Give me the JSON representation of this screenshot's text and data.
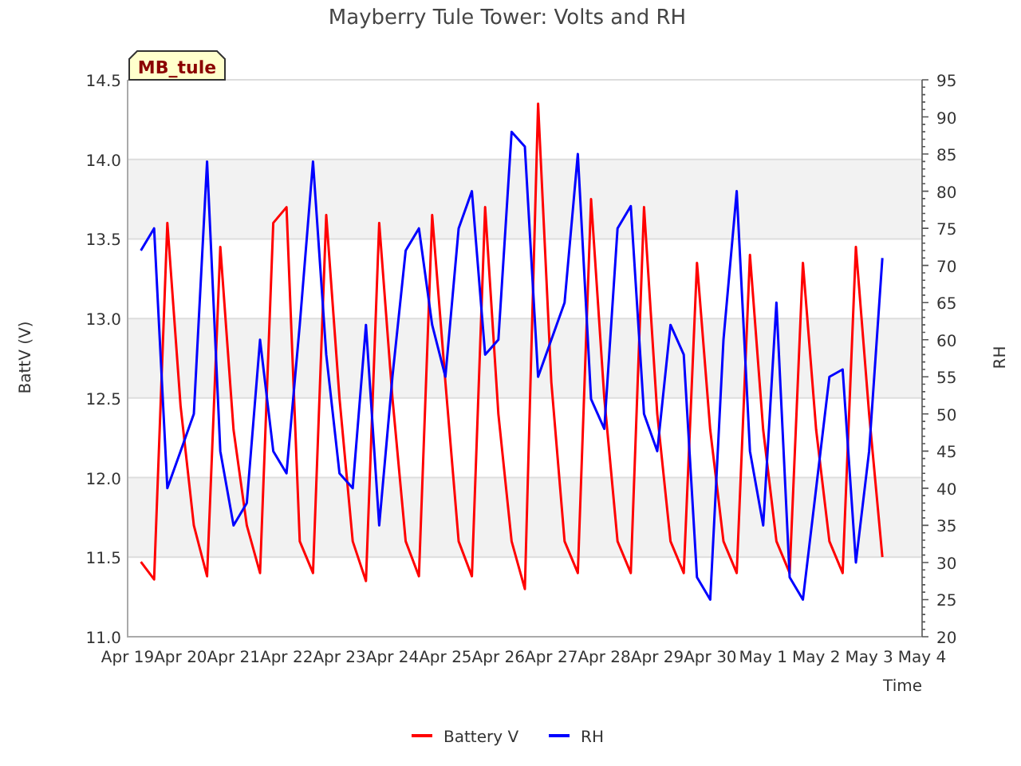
{
  "station_label": "MB_tule",
  "chart_data": {
    "type": "line",
    "title": "Mayberry Tule Tower: Volts and RH",
    "xlabel": "Time",
    "ylabel": "BattV (V)",
    "y2label": "RH",
    "categories": [
      "Apr 19",
      null,
      null,
      null,
      "Apr 20",
      null,
      null,
      null,
      "Apr 21",
      null,
      null,
      null,
      "Apr 22",
      null,
      null,
      null,
      "Apr 23",
      null,
      null,
      null,
      "Apr 24",
      null,
      null,
      null,
      "Apr 25",
      null,
      null,
      null,
      "Apr 26",
      null,
      null,
      null,
      "Apr 27",
      null,
      null,
      null,
      "Apr 28",
      null,
      null,
      null,
      "Apr 29",
      null,
      null,
      null,
      "Apr 30",
      null,
      null,
      null,
      "May 1",
      null,
      null,
      null,
      "May 2",
      null,
      null,
      null,
      "May 3",
      null,
      null,
      null,
      "May 4"
    ],
    "series": [
      {
        "name": "Battery V",
        "color": "#ff0000",
        "values": [
          null,
          11.47,
          11.36,
          13.6,
          12.45,
          11.7,
          11.38,
          13.45,
          12.3,
          11.7,
          11.4,
          13.6,
          13.7,
          11.6,
          11.4,
          13.65,
          12.5,
          11.6,
          11.35,
          13.6,
          12.5,
          11.6,
          11.38,
          13.65,
          12.6,
          11.6,
          11.38,
          13.7,
          12.4,
          11.6,
          11.3,
          14.35,
          12.6,
          11.6,
          11.4,
          13.75,
          12.5,
          11.6,
          11.4,
          13.7,
          12.4,
          11.6,
          11.4,
          13.35,
          12.3,
          11.6,
          11.4,
          13.4,
          12.3,
          11.6,
          11.4,
          13.35,
          12.3,
          11.6,
          11.4,
          13.45,
          12.4,
          11.5,
          null,
          null,
          null
        ]
      },
      {
        "name": "RH",
        "color": "#0000ff",
        "axis": "y2",
        "values": [
          null,
          72,
          75,
          40,
          45,
          50,
          84,
          45,
          35,
          38,
          60,
          45,
          42,
          62,
          84,
          58,
          42,
          40,
          62,
          35,
          55,
          72,
          75,
          62,
          55,
          75,
          80,
          58,
          60,
          88,
          86,
          55,
          60,
          65,
          85,
          52,
          48,
          75,
          78,
          50,
          45,
          62,
          58,
          28,
          25,
          60,
          80,
          45,
          35,
          65,
          28,
          25,
          40,
          55,
          56,
          30,
          45,
          71,
          null,
          null,
          null
        ]
      }
    ],
    "grid": true,
    "legend": "bottom",
    "ylim": [
      11,
      14.5
    ],
    "y2lim": [
      20,
      95
    ],
    "yticks": [
      {
        "value": 11,
        "label": "11.0"
      },
      {
        "value": 11.5,
        "label": "11.5"
      },
      {
        "value": 12,
        "label": "12.0"
      },
      {
        "value": 12.5,
        "label": "12.5"
      },
      {
        "value": 13,
        "label": "13.0"
      },
      {
        "value": 13.5,
        "label": "13.5"
      },
      {
        "value": 14,
        "label": "14.0"
      },
      {
        "value": 14.5,
        "label": "14.5"
      }
    ],
    "y2ticks": [
      20,
      25,
      30,
      35,
      40,
      45,
      50,
      55,
      60,
      65,
      70,
      75,
      80,
      85,
      90,
      95
    ]
  }
}
